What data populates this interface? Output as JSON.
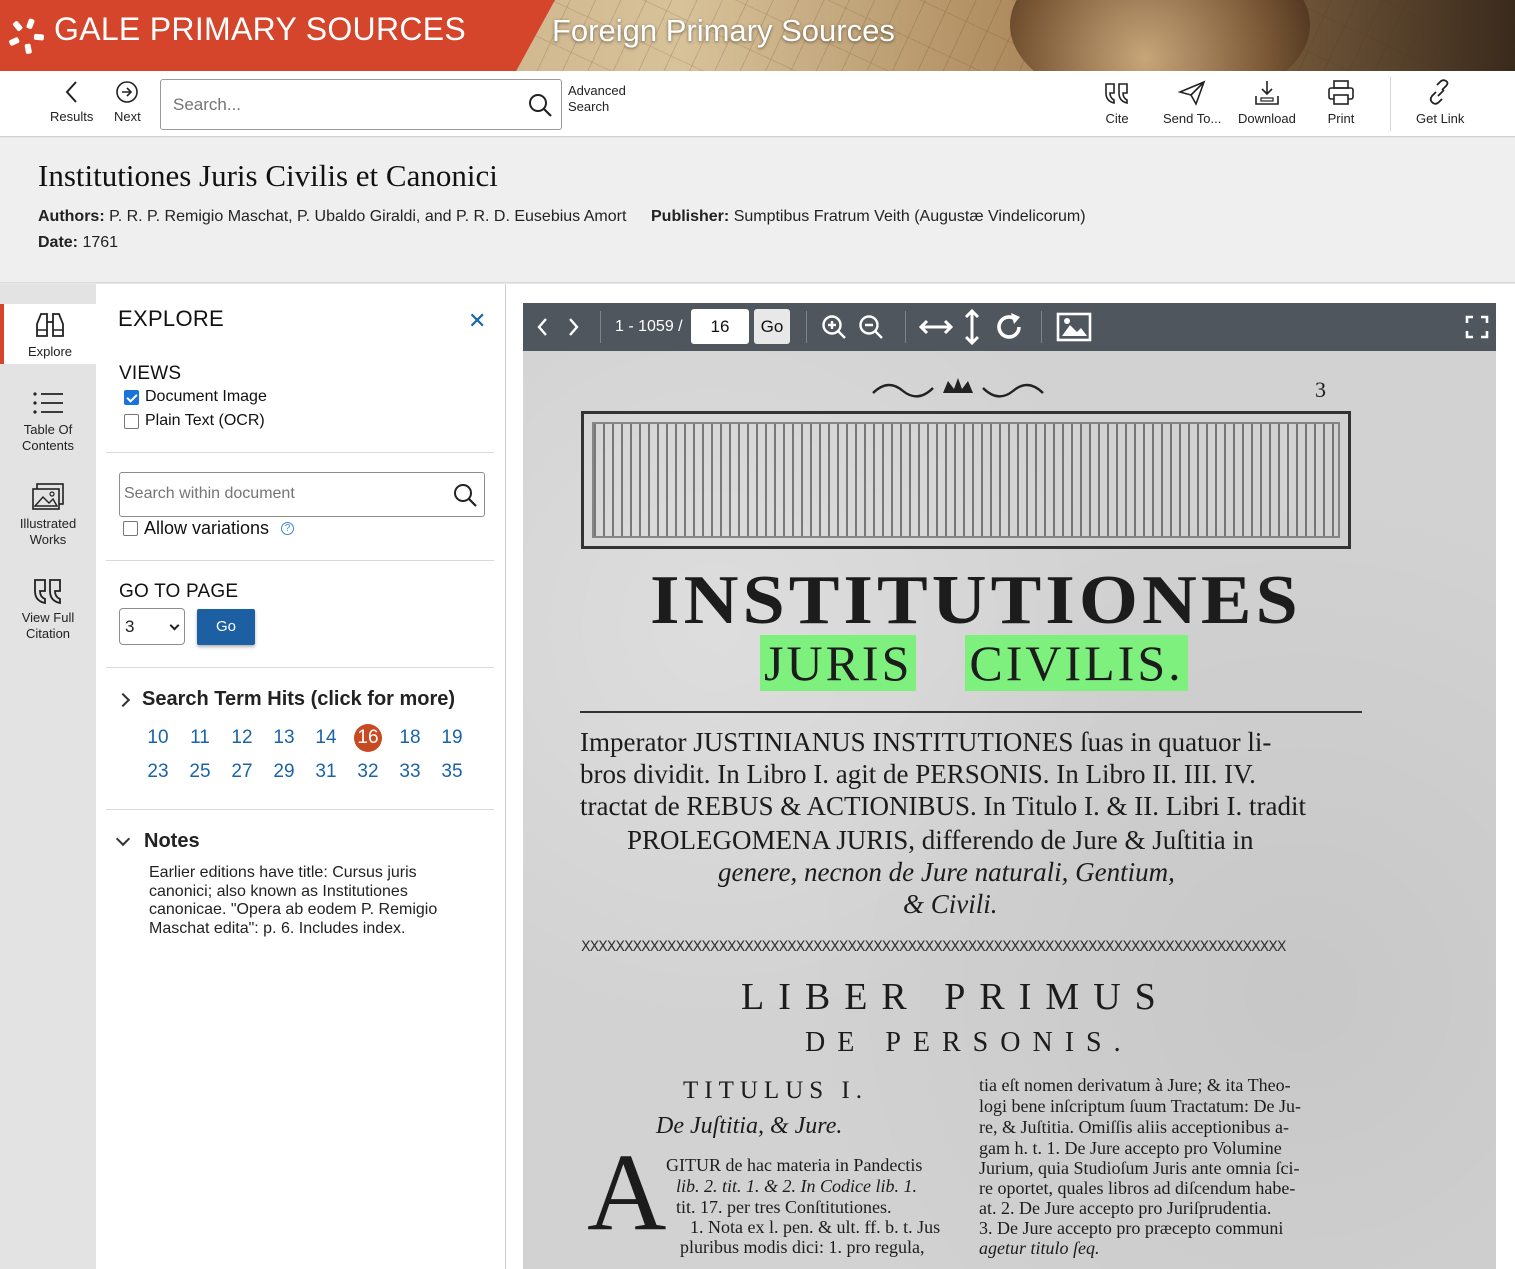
{
  "banner": {
    "brand": "GALE PRIMARY SOURCES",
    "collection": "Foreign Primary Sources",
    "brand_color": "#d5452b"
  },
  "toolbar": {
    "results_label": "Results",
    "next_label": "Next",
    "search_placeholder": "Search...",
    "advanced_line1": "Advanced",
    "advanced_line2": "Search",
    "cite_label": "Cite",
    "send_label": "Send To...",
    "download_label": "Download",
    "print_label": "Print",
    "getlink_label": "Get Link"
  },
  "document": {
    "title": "Institutiones Juris Civilis et Canonici",
    "authors_label": "Authors:",
    "authors": "P. R. P. Remigio Maschat, P. Ubaldo Giraldi, and P. R. D. Eusebius Amort",
    "publisher_label": "Publisher:",
    "publisher": "Sumptibus Fratrum Veith (Augustæ Vindelicorum)",
    "date_label": "Date:",
    "date": "1761"
  },
  "rail": {
    "explore": "Explore",
    "toc_line1": "Table Of",
    "toc_line2": "Contents",
    "illus_line1": "Illustrated",
    "illus_line2": "Works",
    "cite_line1": "View Full",
    "cite_line2": "Citation"
  },
  "explore": {
    "heading": "EXPLORE",
    "views_label": "VIEWS",
    "view_image": "Document Image",
    "view_ocr": "Plain Text (OCR)",
    "within_placeholder": "Search within document",
    "allow_variations": "Allow variations",
    "help_glyph": "?",
    "goto_label": "GO TO PAGE",
    "goto_value": "3",
    "go_label": "Go",
    "hits_label": "Search Term Hits (click for more)",
    "hits": [
      "10",
      "11",
      "12",
      "13",
      "14",
      "16",
      "18",
      "19",
      "23",
      "25",
      "27",
      "29",
      "31",
      "32",
      "33",
      "35"
    ],
    "current_hit": "16",
    "notes_label": "Notes",
    "notes_text": "Earlier editions have title: Cursus juris canonici; also known as Institutiones canonicae. \"Opera ab eodem P. Remigio Maschat edita\": p. 6. Includes index."
  },
  "viewer": {
    "range": "1 - 1059 /",
    "page_value": "16",
    "go_label": "Go",
    "toolbar_color": "#4f565d"
  },
  "page_scan": {
    "page_number": "3",
    "title_main": "INSTITUTIONES",
    "title_sub_1": "JURIS",
    "title_sub_2": "CIVILIS.",
    "highlight_color": "#7ef07e",
    "para_1": "Imperator JUSTINIANUS INSTITUTIONES ſuas in quatuor li-",
    "para_2": "bros dividit. In Libro I. agit de PERSONIS. In Libro II. III. IV.",
    "para_3": "tractat de REBUS & ACTIONIBUS. In Titulo I. & II. Libri I. tradit",
    "para_4": "PROLEGOMENA JURIS, differendo de Jure & Juſtitia in",
    "para_5": "genere, necnon de Jure naturali, Gentium,",
    "para_6": "& Civili.",
    "xrow": "XXXXXXXXXXXXXXXXXXXXXXXXXXXXXXXXXXXXXXXXXXXXXXXXXXXXXXXXXXXXXXXXXXXXXXXXXXXXXXXXXX",
    "liber": "LIBER PRIMUS",
    "de_personis": "DE PERSONIS.",
    "titulus": "TITULUS I.",
    "de_justitia": "De Juſtitia, & Jure.",
    "dropcap": "A",
    "left_1": "GITUR de hac materia in Pandectis",
    "left_2": "lib. 2. tit. 1. & 2. In Codice lib. 1.",
    "left_3": "tit. 17. per tres Conſtitutiones.",
    "left_4": "1. Nota ex l. pen. & ult. ff. b. t. Jus",
    "left_5": "pluribus modis dici: 1. pro regula,",
    "right_1": "tia eſt nomen derivatum à Jure; & ita Theo-",
    "right_2": "logi bene inſcriptum ſuum Tractatum: De Ju-",
    "right_3": "re, & Juſtitia. Omiſſis aliis acceptionibus a-",
    "right_4": "gam h. t. 1. De Jure accepto pro Volumine",
    "right_5": "Jurium, quia Studioſum Juris ante omnia ſci-",
    "right_6": "re oportet, quales libros ad diſcendum habe-",
    "right_7": "at. 2. De Jure accepto pro Juriſprudentia.",
    "right_8": "3. De Jure accepto pro præcepto communi",
    "right_9": "agetur titulo ſeq."
  }
}
